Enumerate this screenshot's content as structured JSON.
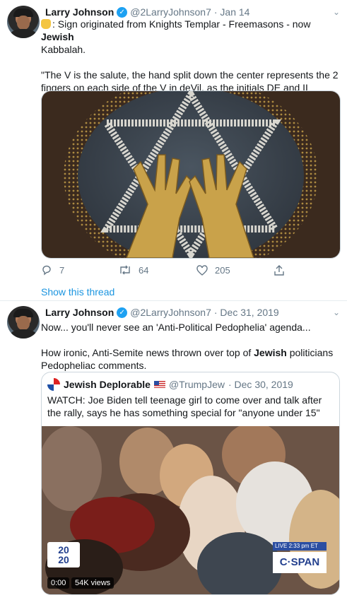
{
  "tweet1": {
    "name": "Larry Johnson",
    "handle": "@2LarryJohnson7",
    "date": "· Jan 14",
    "line1": ": Sign originated from Knights Templar - Freemasons - now",
    "line1_bold": "Jewish",
    "line2": "Kabbalah.",
    "quote": "\"The V is the salute, the hand split down the center represents the 2 fingers on each side of the V in deVil, as the initials DE and IL represents the fingers.\" -T. Stokes (British Intelligence)",
    "replies": "7",
    "retweets": "64",
    "likes": "205",
    "show_thread": "Show this thread"
  },
  "tweet2": {
    "name": "Larry Johnson",
    "handle": "@2LarryJohnson7",
    "date": "· Dec 31, 2019",
    "line1": "Now... you'll never see an 'Anti-Political Pedophelia' agenda...",
    "line2_pre": "How ironic, Anti-Semite news thrown over top of",
    "line2_bold": "Jewish",
    "line2_post": "politicians Pedopheliac comments.",
    "quoted": {
      "name": "Jewish Deplorable",
      "handle": "@TrumpJew",
      "date": "· Dec 30, 2019",
      "text": "WATCH: Joe Biden tell teenage girl to come over and talk after the rally, says he has something special for \"anyone under 15\"",
      "logo_top": "20",
      "logo_bottom": "20",
      "live_label": "LIVE  2:33 pm ET",
      "network": "C·SPAN",
      "time": "0:00",
      "views": "54K views"
    }
  },
  "colors": {
    "link": "#1b95e0",
    "verified": "#1da1f2",
    "muted": "#657786"
  },
  "icons": [
    "verified-icon",
    "chevron-down-icon",
    "reply-icon",
    "retweet-icon",
    "like-icon",
    "share-icon"
  ]
}
